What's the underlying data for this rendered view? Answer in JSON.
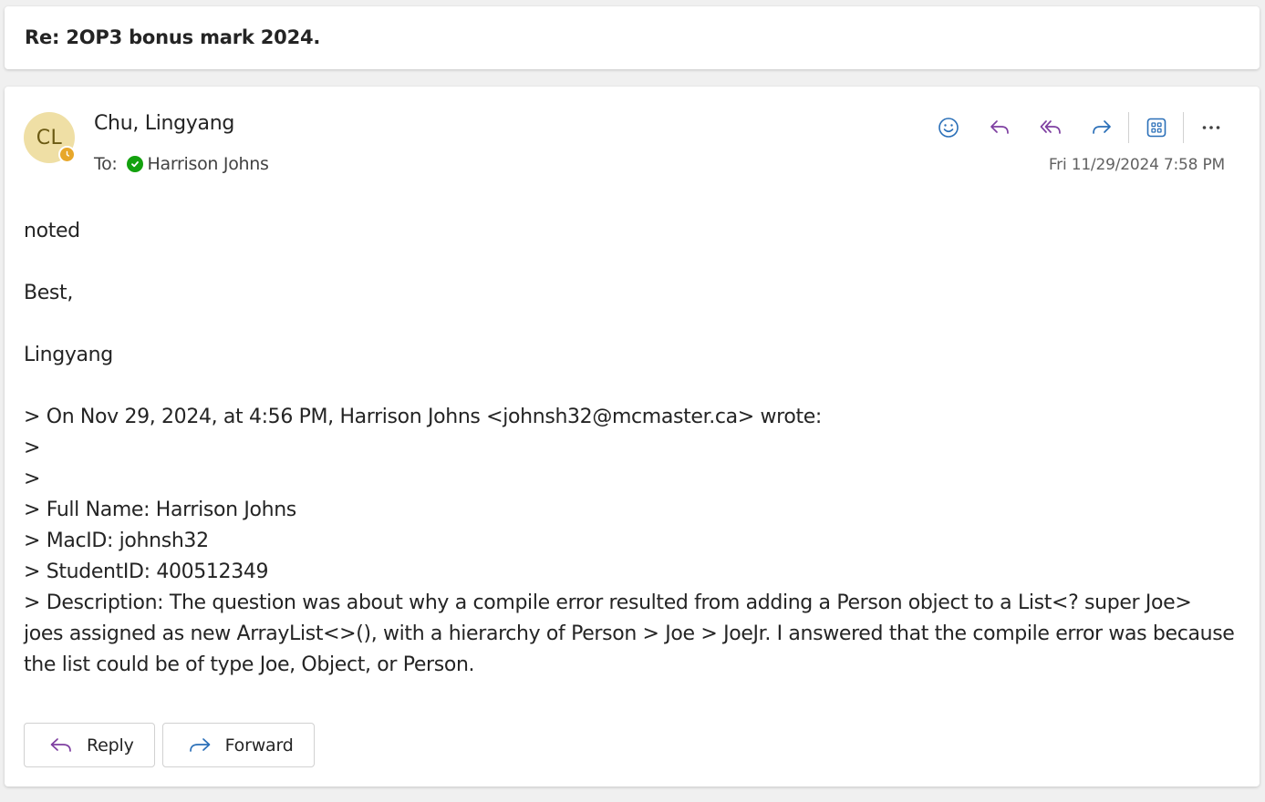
{
  "subject": "Re: 2OP3 bonus mark 2024.",
  "message": {
    "avatar_initials": "CL",
    "sender": "Chu, Lingyang",
    "to_label": "To:",
    "recipient": "Harrison Johns",
    "timestamp": "Fri 11/29/2024 7:58 PM"
  },
  "toolbar": {
    "icons": [
      "emoji-icon",
      "reply-icon",
      "reply-all-icon",
      "forward-icon",
      "apps-icon",
      "more-icon"
    ]
  },
  "body": {
    "lines": [
      "noted",
      "",
      "Best,",
      "",
      "Lingyang",
      "",
      "> On Nov 29, 2024, at 4:56 PM, Harrison Johns <johnsh32@mcmaster.ca> wrote:",
      ">",
      ">",
      "> Full Name: Harrison Johns",
      "> MacID: johnsh32",
      "> StudentID: 400512349",
      "> Description: The question was about why a compile error resulted from adding a Person object to a List<? super Joe> joes assigned as new ArrayList<>(), with a hierarchy of Person > Joe > JoeJr. I answered that the compile error was because the list could be of type Joe, Object, or Person."
    ]
  },
  "actions": {
    "reply_label": "Reply",
    "forward_label": "Forward"
  },
  "colors": {
    "reply_purple": "#7e3fa1",
    "forward_blue": "#2a6fb8",
    "presence_away": "#e7a72b",
    "presence_available": "#13a10e",
    "avatar_bg": "#efdfa5"
  }
}
